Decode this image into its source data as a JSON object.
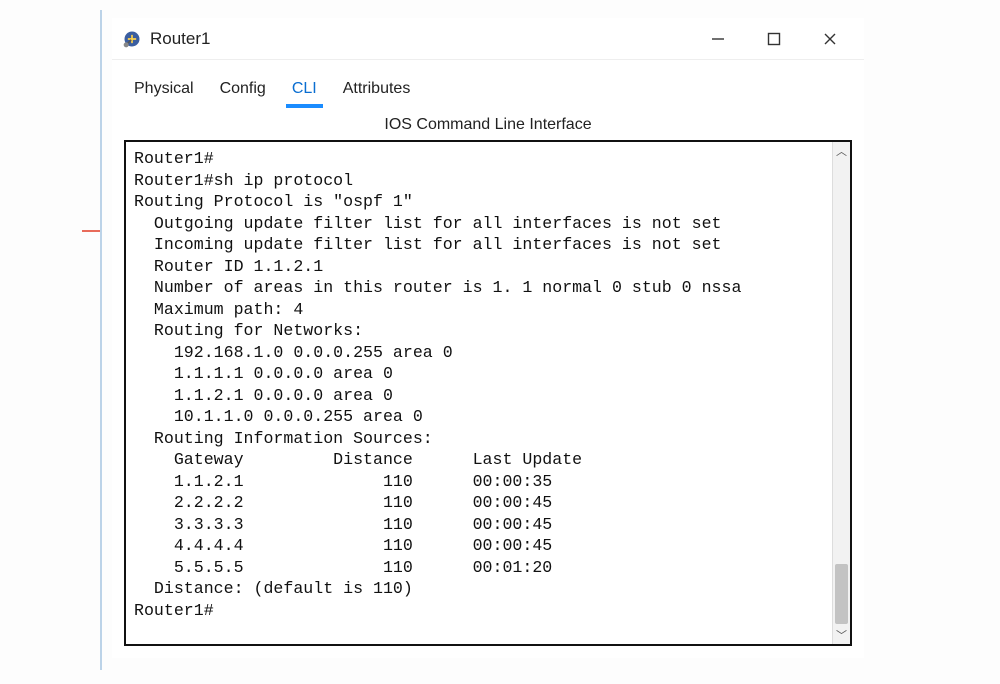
{
  "window": {
    "title": "Router1"
  },
  "tabs": [
    {
      "label": "Physical"
    },
    {
      "label": "Config"
    },
    {
      "label": "CLI"
    },
    {
      "label": "Attributes"
    }
  ],
  "active_tab_index": 2,
  "subtitle": "IOS Command Line Interface",
  "terminal_lines": [
    "Router1#",
    "Router1#sh ip protocol",
    "",
    "Routing Protocol is \"ospf 1\"",
    "  Outgoing update filter list for all interfaces is not set",
    "  Incoming update filter list for all interfaces is not set",
    "  Router ID 1.1.2.1",
    "  Number of areas in this router is 1. 1 normal 0 stub 0 nssa",
    "  Maximum path: 4",
    "  Routing for Networks:",
    "    192.168.1.0 0.0.0.255 area 0",
    "    1.1.1.1 0.0.0.0 area 0",
    "    1.1.2.1 0.0.0.0 area 0",
    "    10.1.1.0 0.0.0.255 area 0",
    "  Routing Information Sources:",
    "    Gateway         Distance      Last Update",
    "    1.1.2.1              110      00:00:35",
    "    2.2.2.2              110      00:00:45",
    "    3.3.3.3              110      00:00:45",
    "    4.4.4.4              110      00:00:45",
    "    5.5.5.5              110      00:01:20",
    "  Distance: (default is 110)",
    "",
    "Router1#"
  ],
  "routing_sources": [
    {
      "gateway": "1.1.2.1",
      "distance": 110,
      "last_update": "00:00:35"
    },
    {
      "gateway": "2.2.2.2",
      "distance": 110,
      "last_update": "00:00:45"
    },
    {
      "gateway": "3.3.3.3",
      "distance": 110,
      "last_update": "00:00:45"
    },
    {
      "gateway": "4.4.4.4",
      "distance": 110,
      "last_update": "00:00:45"
    },
    {
      "gateway": "5.5.5.5",
      "distance": 110,
      "last_update": "00:01:20"
    }
  ]
}
